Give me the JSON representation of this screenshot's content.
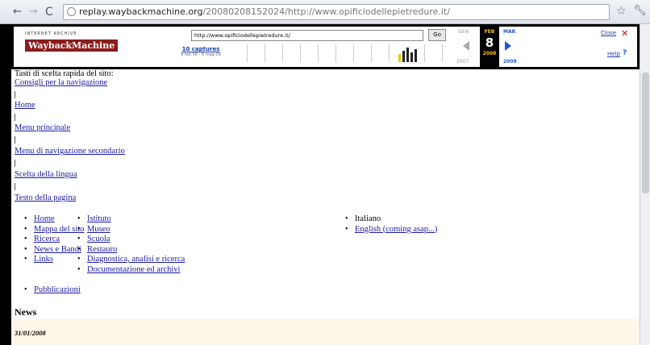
{
  "browser": {
    "url_host": "replay.waybackmachine.org",
    "url_path": "/20080208152024/http://www.opificiodellepietredure.it/"
  },
  "wayback": {
    "logo_top": "INTERNET ARCHIVE",
    "logo_main": "WaybackMachine",
    "url_value": "http://www.opificiodellepietredure.it/",
    "go_label": "Go",
    "captures_label": "10 captures",
    "captures_range": "8 feb 08 - 8 mag 09",
    "prev_month": "GEN",
    "cur_month": "FEB",
    "next_month": "MAR",
    "cur_day": "8",
    "prev_year": "2007",
    "cur_year": "2008",
    "next_year": "2009",
    "close_label": "Close",
    "help_label": "Help"
  },
  "page": {
    "skip_heading": "Tasti di scelta rapida del sito:",
    "skip_links": [
      "Consigli per la navigazione",
      "Home",
      "Menu principale",
      "Menu di navigazione secondario",
      "Scelta della lingua",
      "Testo della pagina"
    ],
    "menu_col1": [
      "Home",
      "Mappa del sito",
      "Ricerca",
      "News e Bandi",
      "Links",
      "Pubblicazioni"
    ],
    "menu_col2": [
      "Istituto",
      "Museo",
      "Scuola",
      "Restauro",
      "Diagnostica, analisi e ricerca",
      "Documentazione ed archivi"
    ],
    "lang_current": "Italiano",
    "lang_other": "English (coming asap...)",
    "news_heading": "News",
    "news_date": "31/01/2008"
  }
}
